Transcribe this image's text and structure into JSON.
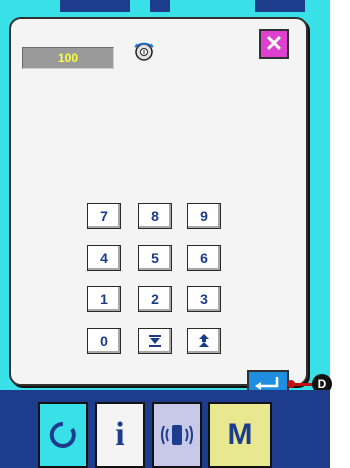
{
  "dialog": {
    "value": "100",
    "dial_icon": "rotary-dial-icon",
    "close_label": "✕"
  },
  "keypad": {
    "rows": [
      [
        "7",
        "8",
        "9"
      ],
      [
        "4",
        "5",
        "6"
      ],
      [
        "1",
        "2",
        "3"
      ],
      [
        "0",
        "",
        ""
      ]
    ],
    "down_icon": "step-down-icon",
    "up_icon": "step-up-icon"
  },
  "enter": {
    "icon": "enter-return-icon",
    "marker": "D"
  },
  "bottom_bar": {
    "info_label": "i",
    "mode_label": "M"
  },
  "colors": {
    "background": "#38e0e8",
    "frame": "#1e3c8c",
    "close": "#e040d0",
    "enter": "#1e8fe0",
    "value_text": "#ffff40",
    "key_text": "#1a3a8a",
    "mode_button": "#e8e890",
    "ready_button": "#38e0e8",
    "info_button": "#f4f4f4",
    "pattern_button": "#c8c8e8"
  }
}
